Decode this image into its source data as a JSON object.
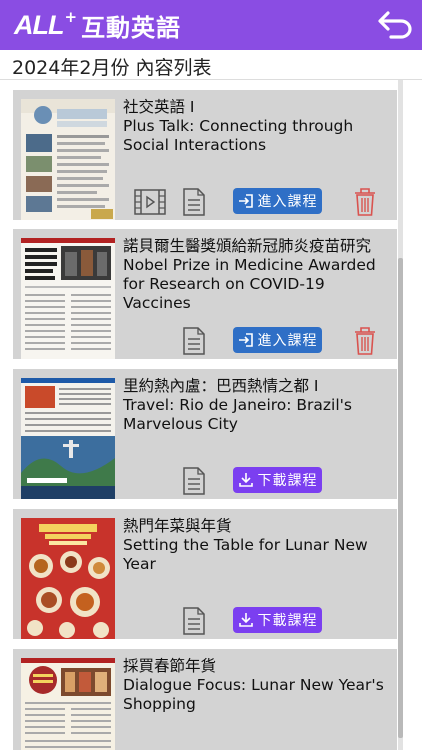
{
  "header": {
    "logo_all": "ALL",
    "logo_plus": "+",
    "logo_text": "互動英語",
    "back_icon": "back-arrow-icon",
    "accent_color": "#8a4de3"
  },
  "subtitle": "2024年2月份 內容列表",
  "items": [
    {
      "title_zh": "社交英語 I",
      "title_en": "Plus Talk: Connecting through Social Interactions",
      "has_video": true,
      "action_label": "進入課程",
      "action_type": "enter",
      "has_delete": true
    },
    {
      "title_zh": "諾貝爾生醫獎頒給新冠肺炎疫苗研究",
      "title_en": "Nobel Prize in Medicine Awarded for Research on COVID-19 Vaccines",
      "has_video": false,
      "action_label": "進入課程",
      "action_type": "enter",
      "has_delete": true
    },
    {
      "title_zh": "里約熱內盧：巴西熱情之都 I",
      "title_en": "Travel: Rio de Janeiro: Brazil's Marvelous City",
      "has_video": false,
      "action_label": "下載課程",
      "action_type": "download",
      "has_delete": false
    },
    {
      "title_zh": "熱門年菜與年貨",
      "title_en": "Setting the Table for Lunar New Year",
      "has_video": false,
      "action_label": "下載課程",
      "action_type": "download",
      "has_delete": false
    },
    {
      "title_zh": "採買春節年貨",
      "title_en": "Dialogue Focus: Lunar New Year's Shopping",
      "has_video": false,
      "action_label": "",
      "action_type": "",
      "has_delete": false
    }
  ],
  "colors": {
    "enter_button": "#2f6fc6",
    "download_button": "#7b3ff0",
    "delete_icon": "#d9534f"
  }
}
